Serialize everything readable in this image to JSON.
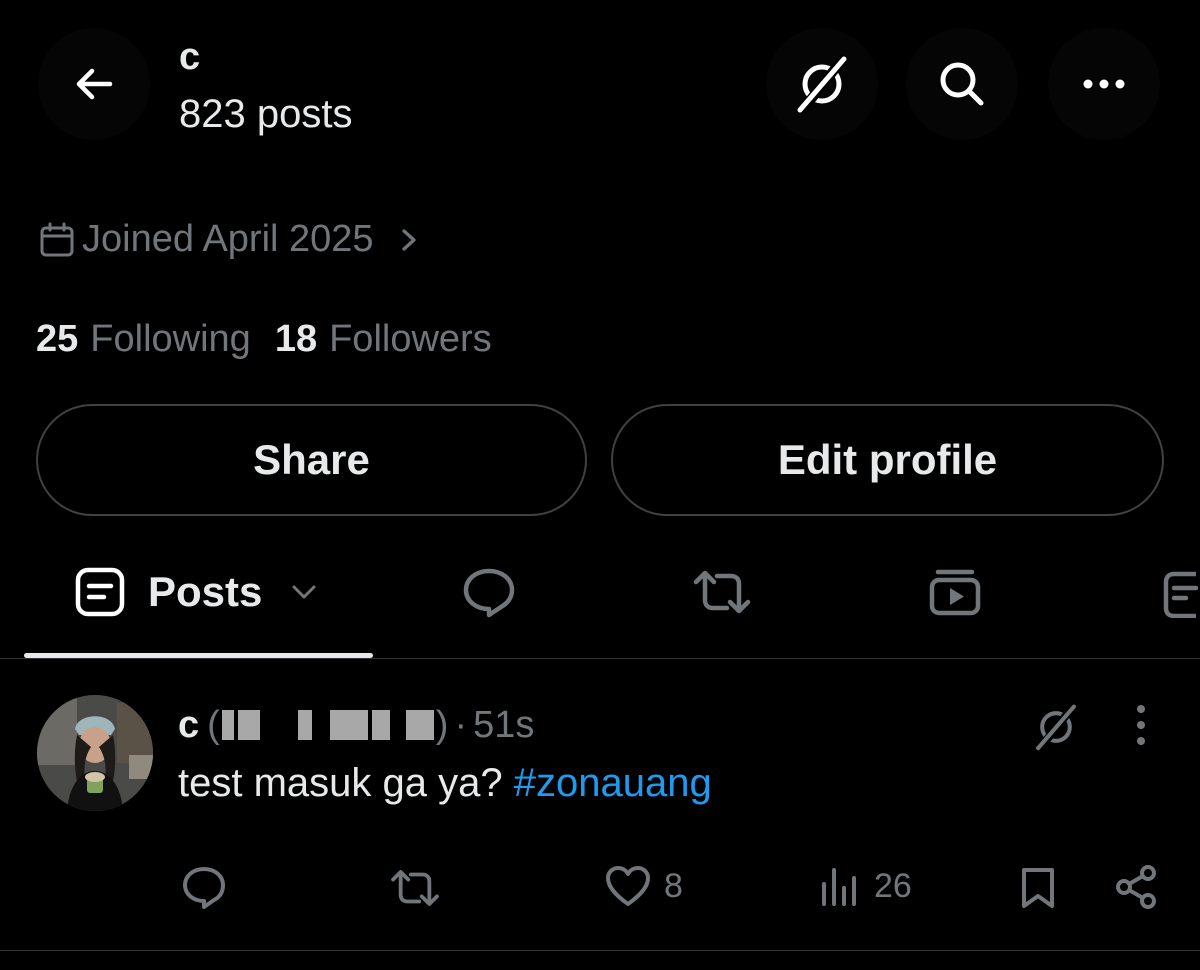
{
  "header": {
    "title": "c",
    "post_count": "823 posts",
    "icons": [
      "arrow-left-icon",
      "grok-icon",
      "search-icon",
      "more-icon"
    ]
  },
  "profile": {
    "joined": "Joined April 2025",
    "following_count": "25",
    "following_label": "Following",
    "followers_count": "18",
    "followers_label": "Followers"
  },
  "buttons": {
    "share": "Share",
    "edit_profile": "Edit profile"
  },
  "tabs": {
    "active_label": "Posts",
    "items": [
      "posts-icon",
      "replies-icon",
      "reposts-icon",
      "videos-icon",
      "articles-icon"
    ]
  },
  "post": {
    "name": "c",
    "handle_prefix": "(",
    "handle_suffix": ")",
    "separator": "·",
    "time": "51s",
    "text": "test masuk ga ya?",
    "hashtag": "#zonauang",
    "likes": "8",
    "views": "26"
  },
  "colors": {
    "background": "#000000",
    "text_primary": "#e7e9ea",
    "text_secondary": "#71767b",
    "link": "#1d9bf0",
    "border": "#3e4144"
  }
}
